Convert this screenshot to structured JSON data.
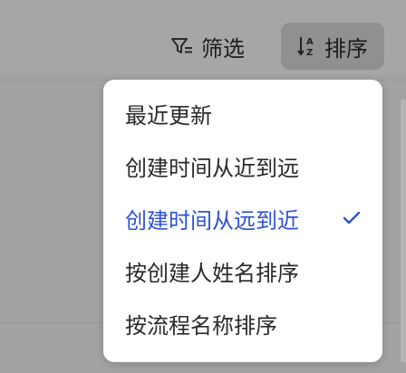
{
  "toolbar": {
    "filter_label": "筛选",
    "filter_icon": "filter-icon",
    "sort_label": "排序",
    "sort_icon": "sort-az-icon"
  },
  "sort_menu": {
    "items": [
      {
        "label": "最近更新",
        "selected": false
      },
      {
        "label": "创建时间从近到远",
        "selected": false
      },
      {
        "label": "创建时间从远到近",
        "selected": true
      },
      {
        "label": "按创建人姓名排序",
        "selected": false
      },
      {
        "label": "按流程名称排序",
        "selected": false
      }
    ],
    "check_icon": "checkmark-icon"
  },
  "colors": {
    "accent": "#2e52d6",
    "menu_background": "#ffffff",
    "overlay": "#a4a4a4"
  }
}
